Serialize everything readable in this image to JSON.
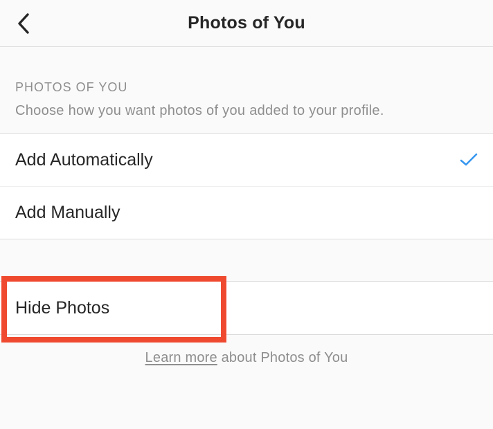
{
  "header": {
    "title": "Photos of You"
  },
  "section": {
    "caption": "PHOTOS OF YOU",
    "description": "Choose how you want photos of you added to your profile."
  },
  "options": {
    "auto_label": "Add Automatically",
    "manual_label": "Add Manually",
    "selected": "auto"
  },
  "hide": {
    "label": "Hide Photos"
  },
  "footer": {
    "learn_more": "Learn more",
    "about_text": " about Photos of You"
  }
}
